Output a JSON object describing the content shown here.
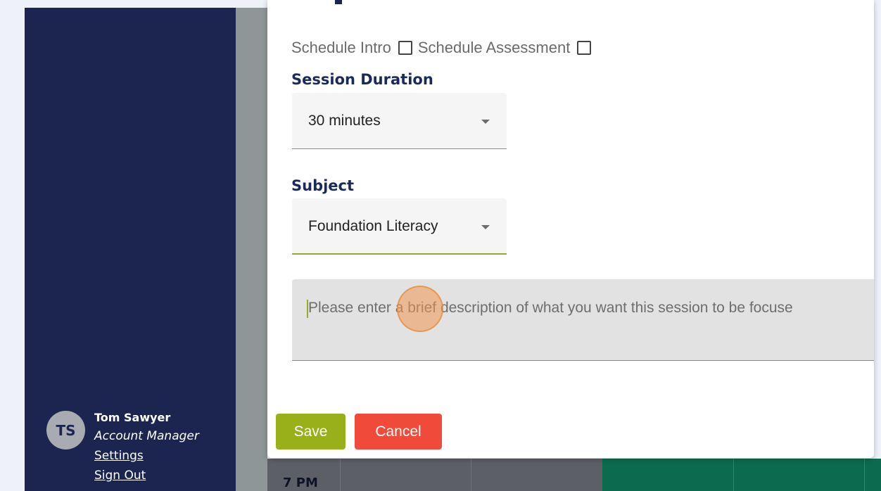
{
  "colors": {
    "sidebar_bg": "#1b2550",
    "accent_green": "#99b01a",
    "cancel_red": "#f04a3a",
    "heading_navy": "#1b2a5c"
  },
  "sidebar": {
    "user": {
      "initials": "TS",
      "name": "Tom Sawyer",
      "role": "Account Manager",
      "settings_link": "Settings",
      "signout_link": "Sign Out"
    }
  },
  "dialog": {
    "checkboxes": {
      "intro_label": "Schedule Intro",
      "intro_checked": false,
      "assessment_label": "Schedule Assessment",
      "assessment_checked": false
    },
    "duration": {
      "label": "Session Duration",
      "selected": "30 minutes",
      "icon": "chevron-down-icon"
    },
    "subject": {
      "label": "Subject",
      "selected": "Foundation Literacy",
      "icon": "chevron-down-icon"
    },
    "description": {
      "placeholder": "Please enter a brief description of what you want this session to be focuse"
    },
    "buttons": {
      "save": "Save",
      "cancel": "Cancel"
    }
  },
  "calendar": {
    "time_label": "7 PM"
  }
}
